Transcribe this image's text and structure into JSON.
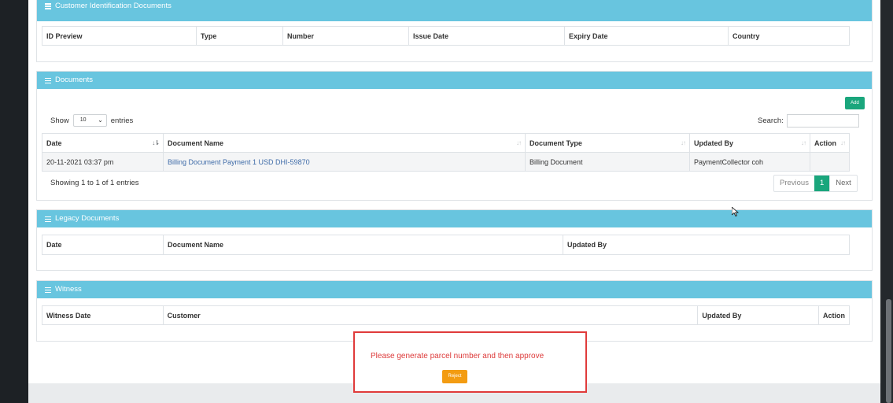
{
  "panels": {
    "customer_id_docs": {
      "title": "Customer Identification Documents",
      "columns": [
        "ID Preview",
        "Type",
        "Number",
        "Issue Date",
        "Expiry Date",
        "Country"
      ]
    },
    "documents": {
      "title": "Documents",
      "add_label": "Add",
      "show_label": "Show",
      "entries_value": "10",
      "entries_label": "entries",
      "search_label": "Search:",
      "search_value": "",
      "columns": [
        "Date",
        "Document Name",
        "Document Type",
        "Updated By",
        "Action"
      ],
      "rows": [
        {
          "date": "20-11-2021 03:37 pm",
          "name": "Billing Document Payment 1 USD DHI-59870",
          "type": "Billing Document",
          "updated_by": "PaymentCollector coh",
          "action": ""
        }
      ],
      "info": "Showing 1 to 1 of 1 entries",
      "pager": {
        "previous": "Previous",
        "current": "1",
        "next": "Next"
      }
    },
    "legacy": {
      "title": "Legacy Documents",
      "columns": [
        "Date",
        "Document Name",
        "Updated By"
      ]
    },
    "witness": {
      "title": "Witness",
      "columns": [
        "Witness Date",
        "Customer",
        "Updated By",
        "Action"
      ]
    }
  },
  "modal": {
    "message": "Please generate parcel number and then approve",
    "reject_label": "Reject"
  },
  "colors": {
    "panel_header": "#68c5df",
    "success": "#1aa67c",
    "warning": "#f39c12",
    "danger": "#e03b3b"
  }
}
